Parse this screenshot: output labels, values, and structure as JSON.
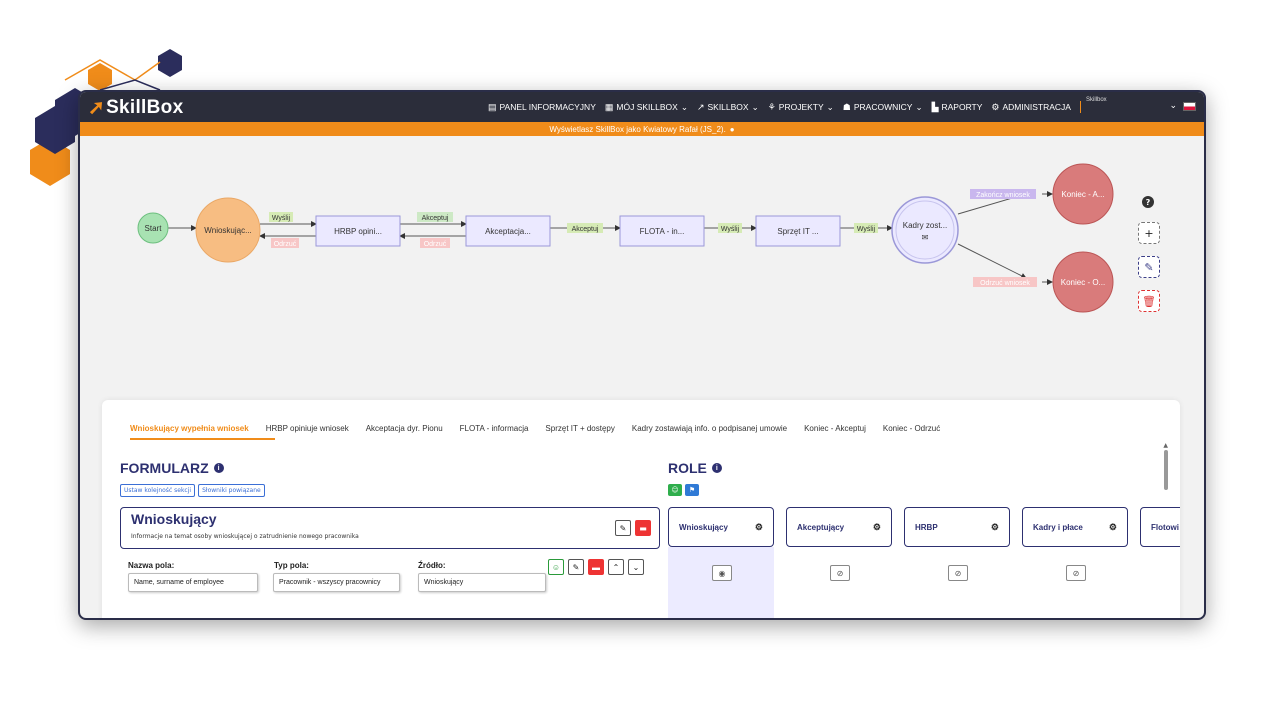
{
  "app": {
    "logo": "SkillBox",
    "user_label": "Skillbox",
    "nav": [
      {
        "label": "PANEL INFORMACYJNY",
        "icon": "▤",
        "chevron": ""
      },
      {
        "label": "MÓJ SKILLBOX",
        "icon": "▦",
        "chevron": "⌄"
      },
      {
        "label": "SKILLBOX",
        "icon": "↗",
        "chevron": "⌄"
      },
      {
        "label": "PROJEKTY",
        "icon": "⚘",
        "chevron": "⌄"
      },
      {
        "label": "PRACOWNICY",
        "icon": "☗",
        "chevron": "⌄"
      },
      {
        "label": "RAPORTY",
        "icon": "▙",
        "chevron": ""
      },
      {
        "label": "ADMINISTRACJA",
        "icon": "⚙",
        "chevron": ""
      }
    ],
    "banner": "Wyświetlasz SkillBox jako Kwiatowy Rafał (JS_2).",
    "banner_icon": "●",
    "accent": "#f08c1a",
    "navy": "#2d3070"
  },
  "graph": {
    "nodes": {
      "start": "Start",
      "wnioskujacy": "Wnioskując...",
      "hrbp": "HRBP opini...",
      "akceptacja": "Akceptacja...",
      "flota": "FLOTA - in...",
      "sprzet": "Sprzęt IT ...",
      "kadry": "Kadry zost...",
      "koniec_a": "Koniec - A...",
      "koniec_o": "Koniec - O..."
    },
    "edges": {
      "wyslij1": "Wyślij",
      "odrzuc1": "Odrzuć",
      "akceptuj1": "Akceptuj",
      "odrzuc2": "Odrzuć",
      "akceptuj2": "Akceptuj",
      "wyslij2": "Wyślij",
      "wyslij3": "Wyślij",
      "zakoncz": "Zakończ wniosek",
      "odrzuc_wniosek": "Odrzuć wniosek"
    },
    "tools": {
      "help": "?",
      "add": "+",
      "edit": "✎",
      "delete": "🗑"
    }
  },
  "tabs": [
    "Wnioskujący wypełnia wniosek",
    "HRBP opiniuje wniosek",
    "Akceptacja dyr. Pionu",
    "FLOTA - informacja",
    "Sprzęt IT + dostępy",
    "Kadry zostawiają info. o podpisanej umowie",
    "Koniec - Akceptuj",
    "Koniec - Odrzuć"
  ],
  "form": {
    "title": "FORMULARZ",
    "btn_order": "Ustaw kolejność sekcji",
    "btn_dict": "Słowniki powiązane",
    "section_title": "Wnioskujący",
    "section_desc": "Informacje na temat osoby wnioskującej o zatrudnienie nowego pracownika",
    "field_name_label": "Nazwa pola:",
    "field_type_label": "Typ pola:",
    "field_source_label": "Źródło:",
    "field_name_value": "Name, surname of employee",
    "field_type_value": "Pracownik - wszyscy pracownicy",
    "field_source_value": "Wnioskujący"
  },
  "roles": {
    "title": "ROLE",
    "items": [
      "Wnioskujący",
      "Akceptujący",
      "HRBP",
      "Kadry i płace",
      "Flotowi"
    ]
  }
}
